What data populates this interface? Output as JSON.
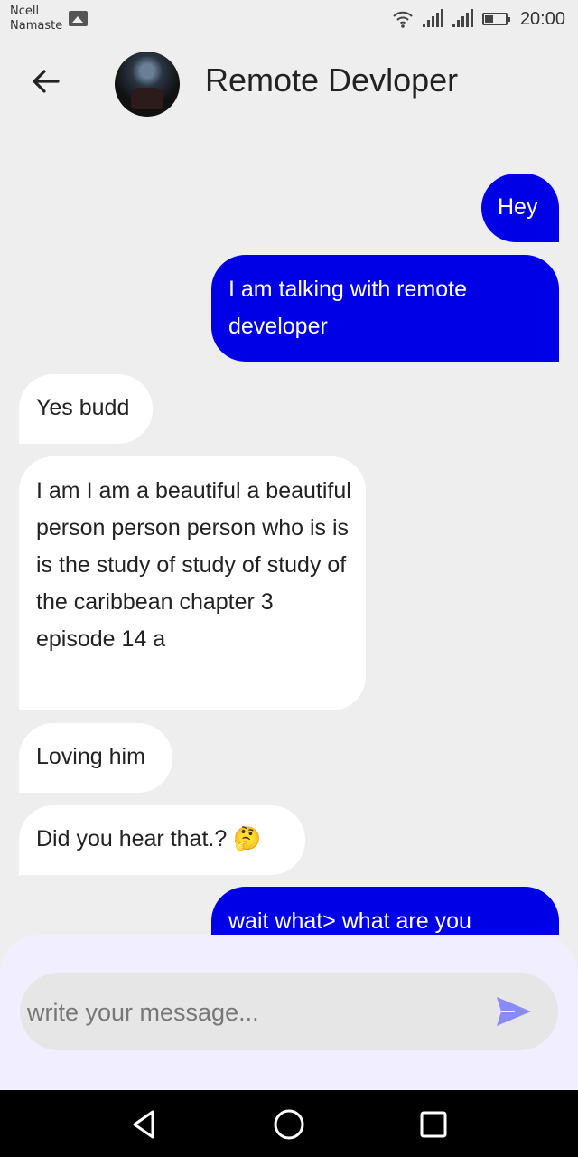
{
  "status_bar": {
    "carrier_line1": "Ncell",
    "carrier_line2": "Namaste",
    "time": "20:00",
    "icons": [
      "gallery-icon",
      "wifi-icon",
      "signal-icon",
      "signal-icon",
      "battery-icon"
    ]
  },
  "header": {
    "title": "Remote Devloper",
    "back_icon": "arrow-left-icon",
    "avatar": "profile-photo"
  },
  "messages": [
    {
      "from": "me",
      "text": "Hey"
    },
    {
      "from": "me",
      "text": "I am talking with remote developer"
    },
    {
      "from": "them",
      "text": "Yes budd"
    },
    {
      "from": "them",
      "text": "I am I am a beautiful a beautiful person person person who is is is the study of study of study of the caribbean chapter 3 episode 14 a"
    },
    {
      "from": "them",
      "text": "Loving him"
    },
    {
      "from": "them",
      "text": "Did you hear that.? 🤔"
    },
    {
      "from": "me",
      "text": "wait what> what are you"
    }
  ],
  "composer": {
    "placeholder": "write your message...",
    "value": "",
    "send_icon": "send-icon"
  },
  "nav": {
    "icons": [
      "back-triangle-icon",
      "home-circle-icon",
      "recents-square-icon"
    ]
  },
  "colors": {
    "outgoing_bubble": "#0000e6",
    "incoming_bubble": "#ffffff",
    "background": "#eeeeee",
    "composer_bg": "#f1efff",
    "send_icon": "#8a8aff"
  }
}
